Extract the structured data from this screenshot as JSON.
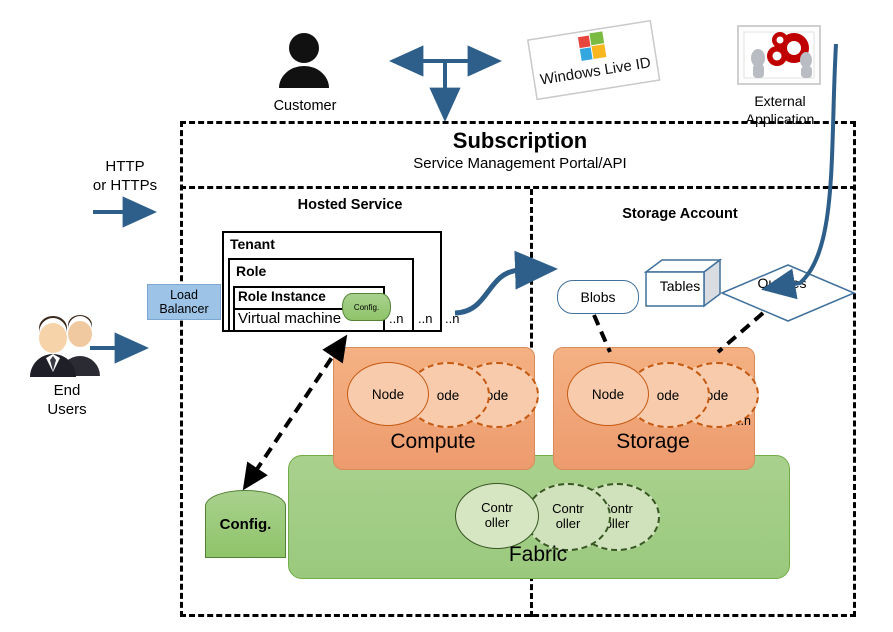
{
  "subscription": {
    "title": "Subscription",
    "subtitle": "Service Management Portal/API",
    "hosted_service_title": "Hosted Service",
    "storage_account_title": "Storage Account"
  },
  "hosted_service": {
    "tenant_label": "Tenant",
    "role_label": "Role",
    "role_instance_label": "Role Instance",
    "virtual_machine_label": "Virtual machine",
    "config_label": "Config.",
    "multiplicity": {
      "instance": "..n",
      "role": "..n",
      "tenant": "..n"
    }
  },
  "load_balancer": {
    "line1": "Load",
    "line2": "Balancer"
  },
  "compute": {
    "label": "Compute",
    "nodes": [
      {
        "label": "Node",
        "style": "solid"
      },
      {
        "label": "ode",
        "style": "dashed"
      },
      {
        "label": "ode",
        "style": "dashed"
      }
    ]
  },
  "storage": {
    "label": "Storage",
    "nodes": [
      {
        "label": "Node",
        "style": "solid"
      },
      {
        "label": "ode",
        "style": "dashed"
      },
      {
        "label": "ode",
        "style": "dashed"
      }
    ],
    "multiplicity": "..n"
  },
  "fabric": {
    "label": "Fabric",
    "controllers": [
      {
        "line1": "Contr",
        "line2": "oller",
        "style": "solid"
      },
      {
        "line1": "Contr",
        "line2": "oller",
        "style": "dashed"
      },
      {
        "line1": "Contr",
        "line2": "oller",
        "style": "dashed"
      }
    ]
  },
  "config_store": {
    "label": "Config."
  },
  "storage_services": {
    "blobs": "Blobs",
    "tables": "Tables",
    "queues": "Queues"
  },
  "actors": {
    "customer": "Customer",
    "end_users_line1": "End",
    "end_users_line2": "Users",
    "external_application_line1": "External",
    "external_application_line2": "Application",
    "identity_provider": "Windows Live ID"
  },
  "protocol_label": {
    "line1": "HTTP",
    "line2": "or HTTPs"
  },
  "colors": {
    "compute_fill": "#f4b183",
    "storage_fill": "#f4b183",
    "fabric_fill": "#a9d18e",
    "node_fill": "#f8cbad",
    "node_stroke": "#c55a11",
    "controller_stroke": "#385723",
    "load_balancer_fill": "#9dc3e6",
    "arrow_blue": "#2e5f8a",
    "shape_stroke_blue": "#41719c"
  }
}
